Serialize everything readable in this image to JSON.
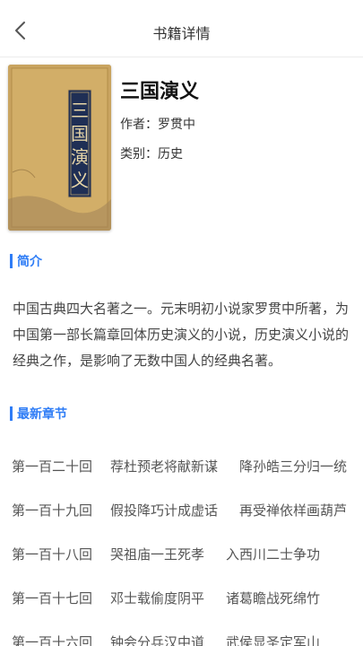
{
  "nav": {
    "title": "书籍详情",
    "back_icon": "chevron-left-icon"
  },
  "book": {
    "title": "三国演义",
    "author_label": "作者：罗贯中",
    "category_label": "类别：历史",
    "cover_text": "三国演义"
  },
  "intro": {
    "heading": "简介",
    "text": "中国古典四大名著之一。元末明初小说家罗贯中所著，为中国第一部长篇章回体历史演义的小说，历史演义小说的经典之作，是影响了无数中国人的经典名著。"
  },
  "chapters": {
    "heading": "最新章节",
    "items": [
      {
        "number": "第一百二十回",
        "title_a": "荐杜预老将献新谋",
        "title_b": "降孙皓三分归一统"
      },
      {
        "number": "第一百十九回",
        "title_a": "假投降巧计成虚话",
        "title_b": "再受禅依样画葫芦"
      },
      {
        "number": "第一百十八回",
        "title_a": "哭祖庙一王死孝",
        "title_b": "入西川二士争功"
      },
      {
        "number": "第一百十七回",
        "title_a": "邓士载偷度阴平",
        "title_b": "诸葛瞻战死绵竹"
      },
      {
        "number": "第一百十六回",
        "title_a": "钟会分兵汉中道",
        "title_b": "武侯显圣定军山"
      }
    ]
  },
  "colors": {
    "accent": "#2f7df6",
    "cover_gold": "#c8a45e",
    "cover_panel": "#1f2f55"
  }
}
